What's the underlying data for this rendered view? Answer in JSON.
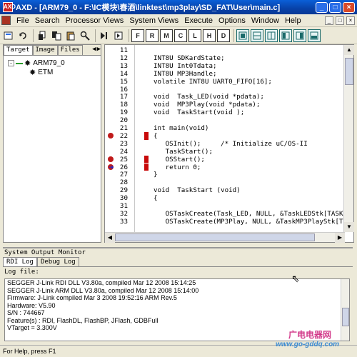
{
  "window": {
    "app_icon_label": "AXD",
    "title": "AXD - [ARM79_0 - F:\\IC模块\\春酒\\linktest\\mp3play\\SD_FAT\\User\\main.c]",
    "controls": [
      "_",
      "□",
      "×"
    ]
  },
  "menubar": {
    "items": [
      "File",
      "Search",
      "Processor Views",
      "System Views",
      "Execute",
      "Options",
      "Window",
      "Help"
    ],
    "doc_controls": [
      "_",
      "□",
      "×"
    ]
  },
  "toolbar": {
    "boxed_labels": [
      "F",
      "R",
      "M",
      "C",
      "L",
      "H",
      "D"
    ]
  },
  "left_panel": {
    "tabs": [
      "Target",
      "Image",
      "Files"
    ],
    "active_tab": "Target",
    "tree": [
      {
        "label": "ARM79_0",
        "level": 0,
        "expander": "-"
      },
      {
        "label": "ETM",
        "level": 1
      }
    ]
  },
  "editor": {
    "lines": [
      {
        "num": "11",
        "code": ""
      },
      {
        "num": "12",
        "code": "INT8U SDKardState;"
      },
      {
        "num": "13",
        "code": "INT8U Int0Tdata;"
      },
      {
        "num": "14",
        "code": "INT8U MP3Handle;"
      },
      {
        "num": "15",
        "code": "volatile INT8U UART0_FIFO[16];"
      },
      {
        "num": "16",
        "code": ""
      },
      {
        "num": "17",
        "code": "void  Task_LED(void *pdata);"
      },
      {
        "num": "18",
        "code": "void  MP3Play(void *pdata);"
      },
      {
        "num": "19",
        "code": "void  TaskStart(void );"
      },
      {
        "num": "20",
        "code": ""
      },
      {
        "num": "21",
        "code": "int main(void)"
      },
      {
        "num": "22",
        "code": "{"
      },
      {
        "num": "23",
        "code": "   OSInit();     /* Initialize uC/OS-II"
      },
      {
        "num": "24",
        "code": "   TaskStart();"
      },
      {
        "num": "25",
        "code": "   OSStart();"
      },
      {
        "num": "26",
        "code": "   return 0;"
      },
      {
        "num": "27",
        "code": "}"
      },
      {
        "num": "28",
        "code": ""
      },
      {
        "num": "29",
        "code": "void  TaskStart (void)"
      },
      {
        "num": "30",
        "code": "{"
      },
      {
        "num": "31",
        "code": ""
      },
      {
        "num": "32",
        "code": "   OSTaskCreate(Task_LED, NULL, &TaskLEDStk[TASK"
      },
      {
        "num": "33",
        "code": "   OSTaskCreate(MP3Play, NULL, &TaskMP3PlayStk[T"
      }
    ],
    "breakpoint_lines": [
      "22",
      "25",
      "26"
    ],
    "current_line": "26"
  },
  "output": {
    "title": "System Output Monitor",
    "tabs": [
      "RDI Log",
      "Debug Log"
    ],
    "active_tab": "RDI Log",
    "log_label": "Log file:",
    "log_lines": [
      "SEGGER J-Link RDI DLL V3.80a, compiled Mar 12 2008 15:14:25",
      "SEGGER J-Link ARM DLL V3.80a, compiled Mar 12 2008 15:14:00",
      "Firmware: J-Link compiled Mar  3 2008 19:52:16 ARM Rev.5",
      "Hardware: V5.90",
      "S/N : 744667",
      "Feature(s) : RDI, FlashDL, FlashBP, JFlash, GDBFull",
      "VTarget = 3.300V"
    ]
  },
  "statusbar": {
    "text": "For Help, press F1"
  },
  "watermark": {
    "cn": "广电电器网",
    "url": "www.go-gddq.com"
  },
  "colors": {
    "titlebar": "#0842a8",
    "breakpoint": "#c01a1a",
    "current_line_arrow": "#1a2ad0",
    "window_bg": "#ece9d8"
  }
}
